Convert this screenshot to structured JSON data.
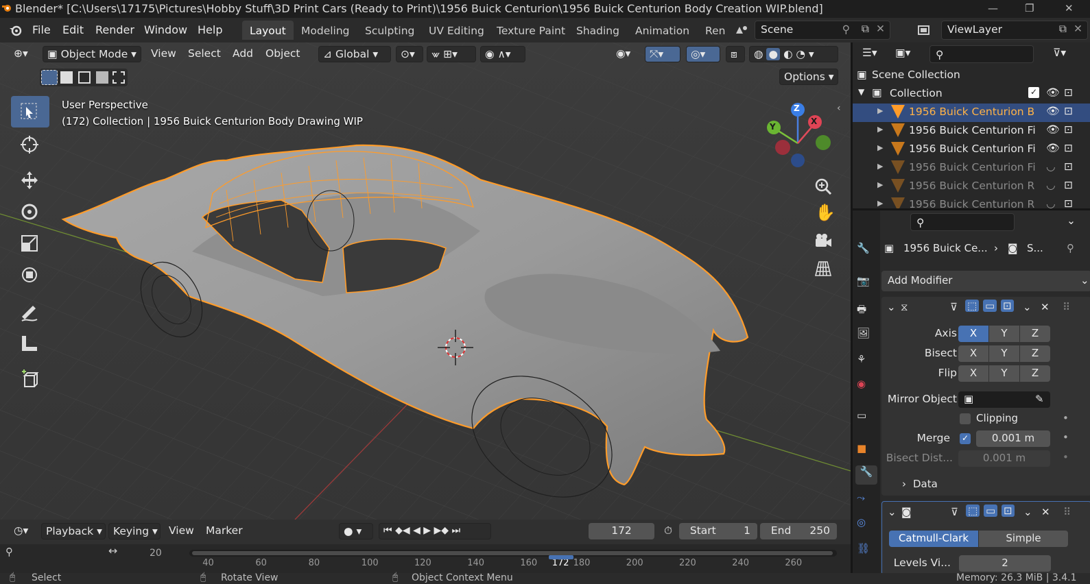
{
  "window": {
    "title": "Blender* [C:\\Users\\17175\\Pictures\\Hobby Stuff\\3D Print Cars (Ready to Print)\\1956 Buick Centurion\\1956 Buick Centurion Body Creation WIP.blend]"
  },
  "menu": {
    "items": [
      "File",
      "Edit",
      "Render",
      "Window",
      "Help"
    ]
  },
  "workspaces": [
    "Layout",
    "Modeling",
    "Sculpting",
    "UV Editing",
    "Texture Paint",
    "Shading",
    "Animation",
    "Ren"
  ],
  "scene": {
    "name": "Scene"
  },
  "view_layer": {
    "name": "ViewLayer"
  },
  "viewport": {
    "mode": "Object Mode",
    "menus": [
      "View",
      "Select",
      "Add",
      "Object"
    ],
    "orientation": "Global",
    "options_label": "Options",
    "view_name": "User Perspective",
    "collection_info": "(172) Collection | 1956 Buick Centurion Body Drawing WIP",
    "gizmo": {
      "x": "X",
      "y": "Y",
      "z": "Z"
    }
  },
  "outliner": {
    "scene_collection": "Scene Collection",
    "collection": "Collection",
    "items": [
      {
        "label": "1956 Buick Centurion B",
        "selected": true,
        "visible": true
      },
      {
        "label": "1956 Buick Centurion Fi",
        "selected": false,
        "visible": true
      },
      {
        "label": "1956 Buick Centurion Fi",
        "selected": false,
        "visible": true
      },
      {
        "label": "1956 Buick Centurion Fi",
        "selected": false,
        "visible": false
      },
      {
        "label": "1956 Buick Centurion R",
        "selected": false,
        "visible": false
      },
      {
        "label": "1956 Buick Centurion R",
        "selected": false,
        "visible": false
      }
    ]
  },
  "properties": {
    "object_name": "1956 Buick Ce...",
    "modifier_short": "S...",
    "add_modifier": "Add Modifier",
    "mirror": {
      "axis_label": "Axis",
      "bisect_label": "Bisect",
      "flip_label": "Flip",
      "x": "X",
      "y": "Y",
      "z": "Z",
      "mirror_object_label": "Mirror Object",
      "clipping_label": "Clipping",
      "merge_label": "Merge",
      "merge_value": "0.001 m",
      "bisect_dist_label": "Bisect Dist...",
      "bisect_dist_value": "0.001 m",
      "data_label": "Data"
    },
    "subsurf": {
      "catmull": "Catmull-Clark",
      "simple": "Simple",
      "levels_label": "Levels Vi...",
      "levels_value": "2"
    }
  },
  "timeline": {
    "menus": [
      "Playback",
      "Keying",
      "View",
      "Marker"
    ],
    "current_frame": "172",
    "start_label": "Start",
    "start_value": "1",
    "end_label": "End",
    "end_value": "250",
    "ruler_start": "20",
    "ruler_ticks": [
      "40",
      "60",
      "80",
      "100",
      "120",
      "140",
      "160",
      "172",
      "180",
      "200",
      "220",
      "240",
      "260"
    ]
  },
  "status": {
    "select": "Select",
    "rotate": "Rotate View",
    "context": "Object Context Menu",
    "memory": "Memory: 26.3 MiB | 3.4.1"
  },
  "colors": {
    "accent": "#4772b3",
    "selection": "#ff9c2a",
    "active_row": "#334d80"
  }
}
